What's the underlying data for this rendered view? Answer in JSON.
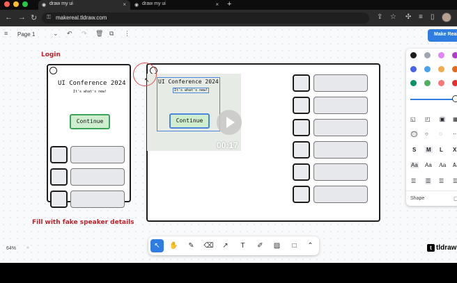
{
  "browser": {
    "tabs": [
      {
        "label": "draw my ui"
      },
      {
        "label": "draw my ui"
      }
    ],
    "url": "makereal.tldraw.com"
  },
  "app": {
    "page_label": "Page 1",
    "make_real_label": "Make Real",
    "zoom": "64%",
    "logo_text": "tldraw"
  },
  "annotations": {
    "login": "Login",
    "fill_note": "Fill with fake speaker details"
  },
  "mockup": {
    "title": "UI Conference 2024",
    "subtitle": "It's what's new!",
    "button": "Continue"
  },
  "video": {
    "timecode": "00:17"
  },
  "style_panel": {
    "colors": [
      "#1d1d1d",
      "#9fa8b2",
      "#e085f4",
      "#ae3ec9",
      "#4465e9",
      "#4ba1f1",
      "#f1ac4b",
      "#e16919",
      "#099268",
      "#4cb05e",
      "#f87777",
      "#e03131"
    ],
    "sizes": [
      "S",
      "M",
      "L",
      "XL"
    ],
    "font_samples": [
      "Aa",
      "Aa",
      "Aa",
      "Aa"
    ],
    "shape_label": "Shape"
  },
  "toolbar": {
    "tools": [
      "select",
      "hand",
      "draw",
      "eraser",
      "arrow",
      "text",
      "note",
      "asset",
      "rectangle",
      "more"
    ]
  }
}
